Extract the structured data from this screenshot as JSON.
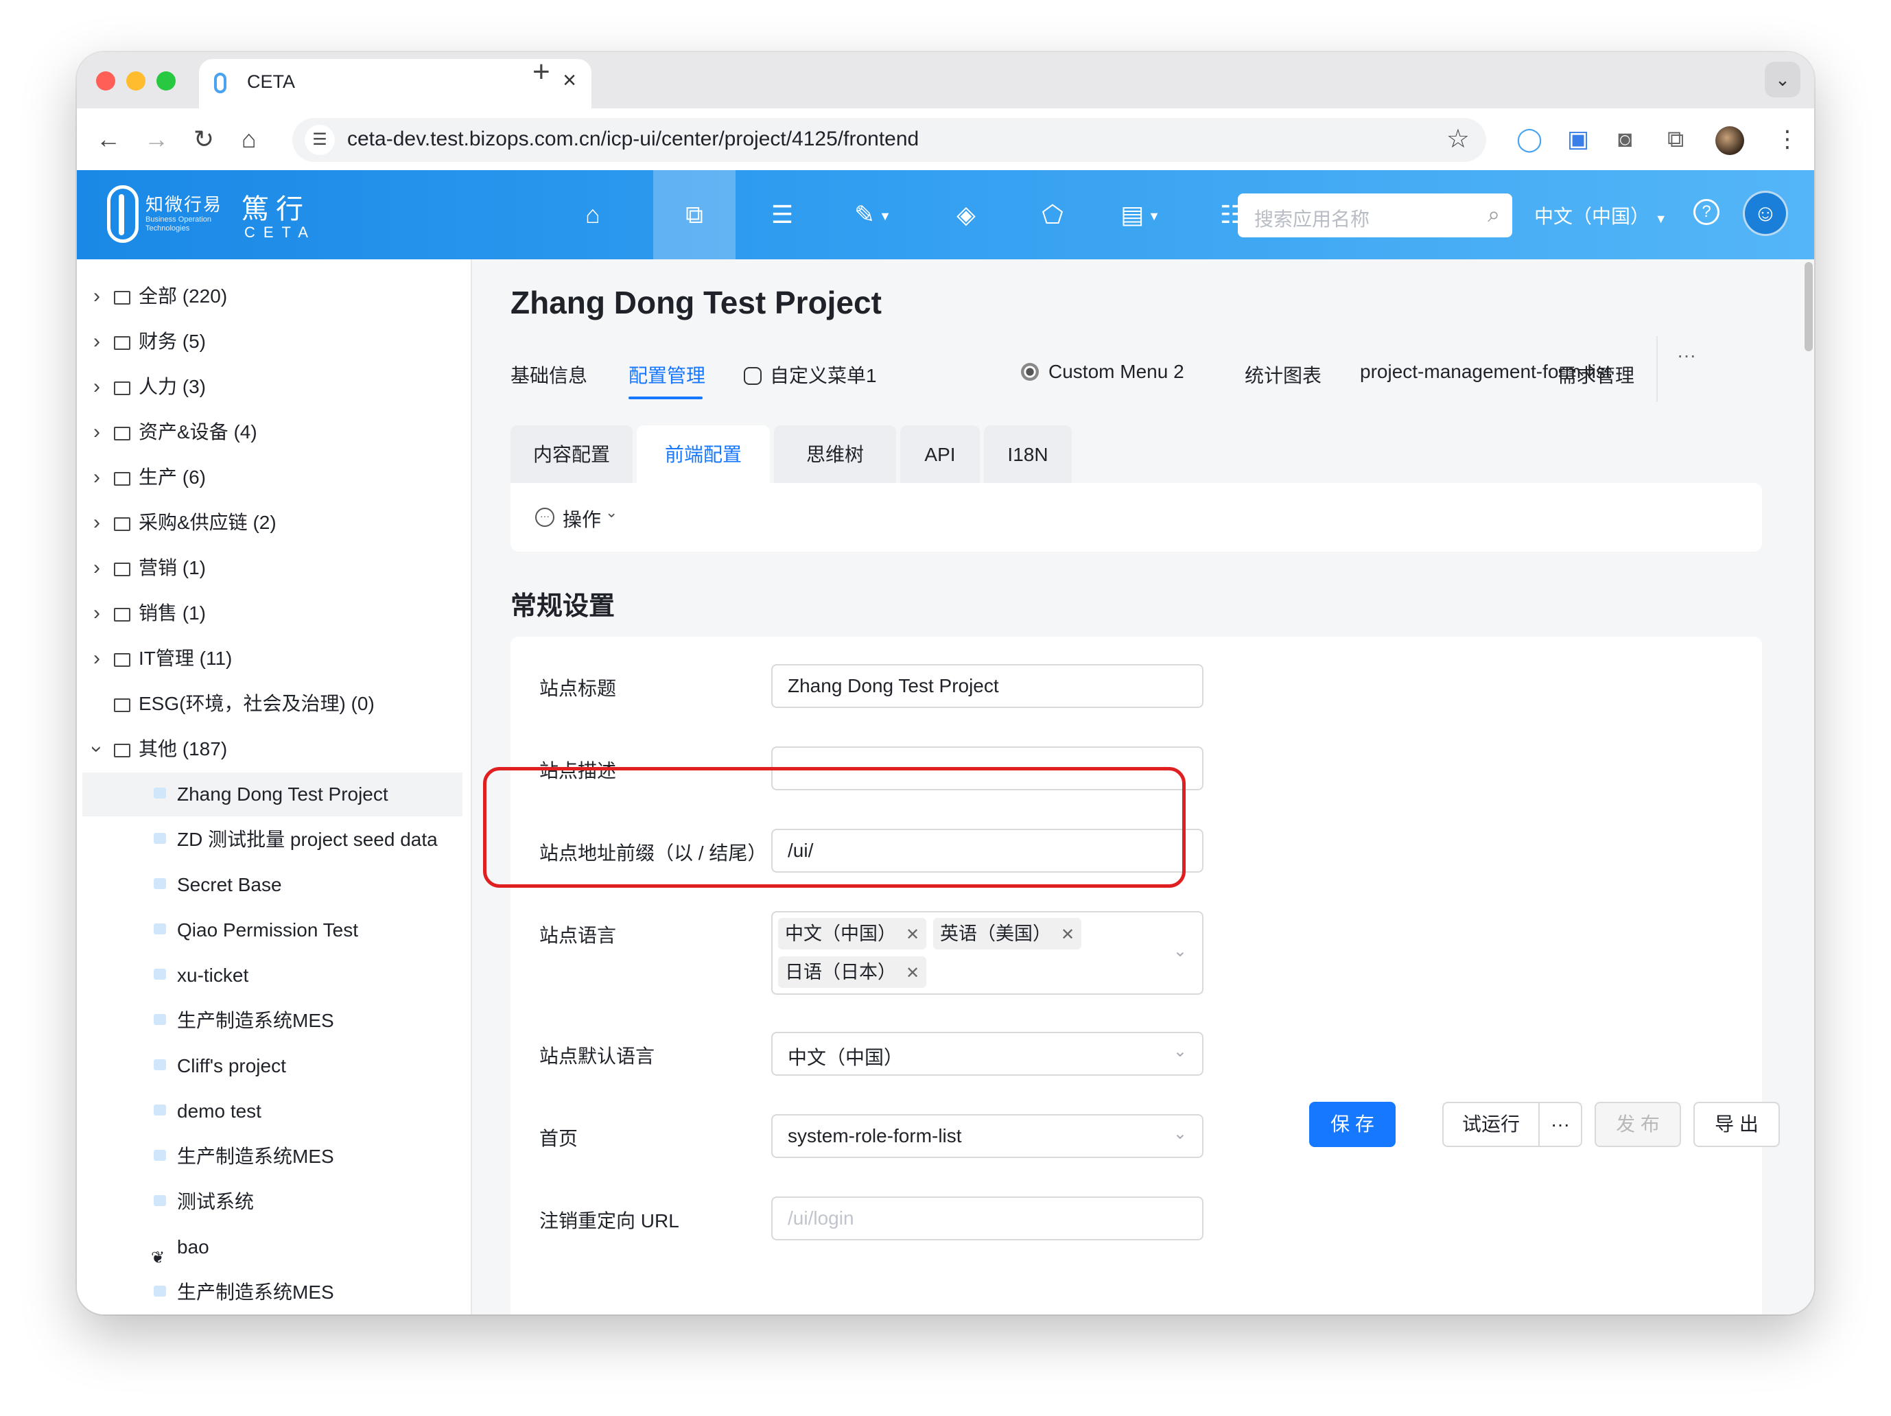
{
  "browser": {
    "tab_title": "CETA",
    "tab_close": "×",
    "new_tab": "+",
    "tab_menu": "⌄",
    "url": "ceta-dev.test.bizops.com.cn/icp-ui/center/project/4125/frontend"
  },
  "app": {
    "logo_cn": "知微行易",
    "logo_sub": "Business Operation Technologies",
    "brand_cn": "篤行",
    "brand_en": "CETA",
    "search_placeholder": "搜索应用名称",
    "language": "中文（中国）"
  },
  "sidebar": {
    "items": [
      {
        "label": "全部 (220)"
      },
      {
        "label": "财务 (5)"
      },
      {
        "label": "人力 (3)"
      },
      {
        "label": "资产&设备 (4)"
      },
      {
        "label": "生产 (6)"
      },
      {
        "label": "采购&供应链 (2)"
      },
      {
        "label": "营销 (1)"
      },
      {
        "label": "销售 (1)"
      },
      {
        "label": "IT管理 (11)"
      },
      {
        "label": "ESG(环境，社会及治理) (0)"
      },
      {
        "label": "其他 (187)"
      }
    ],
    "children": [
      {
        "label": "Zhang Dong Test Project"
      },
      {
        "label": "ZD 测试批量 project seed data"
      },
      {
        "label": "Secret Base"
      },
      {
        "label": "Qiao Permission Test"
      },
      {
        "label": "xu-ticket"
      },
      {
        "label": "生产制造系统MES"
      },
      {
        "label": "Cliff's project"
      },
      {
        "label": "demo test"
      },
      {
        "label": "生产制造系统MES"
      },
      {
        "label": "测试系统"
      },
      {
        "label": "bao"
      },
      {
        "label": "生产制造系统MES"
      }
    ]
  },
  "main": {
    "title": "Zhang Dong Test Project",
    "tabs": [
      {
        "label": "基础信息"
      },
      {
        "label": "配置管理"
      },
      {
        "label": "自定义菜单1"
      },
      {
        "label": "Custom Menu 2"
      },
      {
        "label": "统计图表"
      },
      {
        "label": "project-management-form-list"
      },
      {
        "label": "需求管理"
      }
    ],
    "more": "···",
    "sub_tabs": [
      {
        "label": "内容配置"
      },
      {
        "label": "前端配置"
      },
      {
        "label": "思维树"
      },
      {
        "label": "API"
      },
      {
        "label": "I18N"
      }
    ],
    "ops_label": "操作",
    "section_title": "常规设置",
    "fields": {
      "site_title": {
        "label": "站点标题",
        "value": "Zhang Dong Test Project"
      },
      "site_desc": {
        "label": "站点描述",
        "value": ""
      },
      "site_prefix": {
        "label": "站点地址前缀（以 / 结尾）",
        "value": "/ui/"
      },
      "site_lang": {
        "label": "站点语言",
        "tags": [
          "中文（中国）",
          "英语（美国）",
          "日语（日本）"
        ]
      },
      "default_lang": {
        "label": "站点默认语言",
        "value": "中文（中国）"
      },
      "home": {
        "label": "首页",
        "value": "system-role-form-list"
      },
      "logout_url": {
        "label": "注销重定向 URL",
        "placeholder": "/ui/login"
      }
    },
    "actions": {
      "save": "保 存",
      "trial": "试运行",
      "more": "···",
      "publish": "发 布",
      "export": "导 出"
    }
  }
}
